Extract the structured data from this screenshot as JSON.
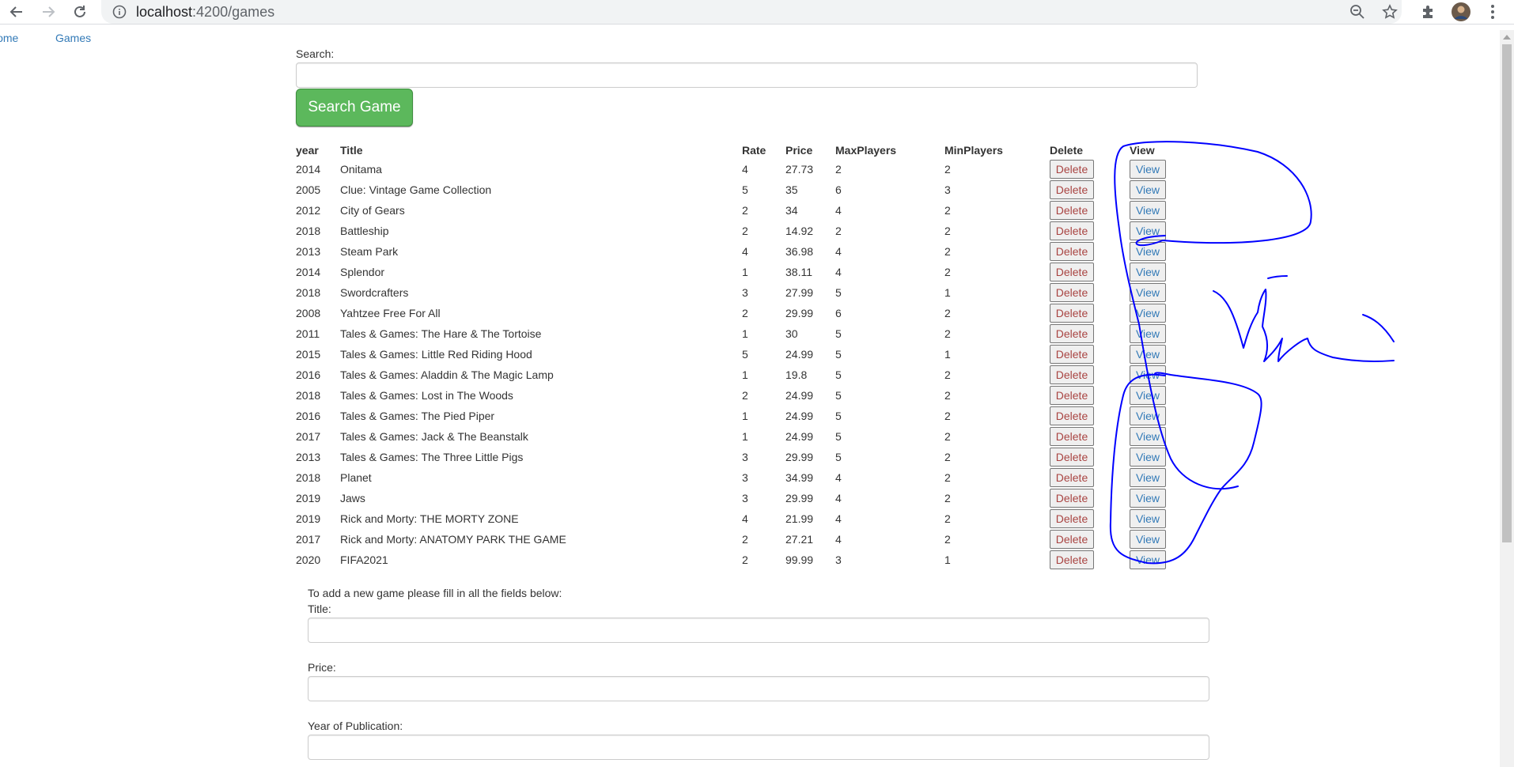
{
  "browser": {
    "url_host": "localhost",
    "url_path": ":4200/games"
  },
  "nav": {
    "home": "Home",
    "games": "Games"
  },
  "search": {
    "label": "Search:",
    "value": "",
    "button": "Search Game"
  },
  "table": {
    "headers": {
      "year": "year",
      "title": "Title",
      "rate": "Rate",
      "price": "Price",
      "max": "MaxPlayers",
      "min": "MinPlayers",
      "delete": "Delete",
      "view": "View"
    },
    "delete_label": "Delete",
    "view_label": "View",
    "rows": [
      {
        "year": "2014",
        "title": "Onitama",
        "rate": "4",
        "price": "27.73",
        "max": "2",
        "min": "2"
      },
      {
        "year": "2005",
        "title": "Clue: Vintage Game Collection",
        "rate": "5",
        "price": "35",
        "max": "6",
        "min": "3"
      },
      {
        "year": "2012",
        "title": "City of Gears",
        "rate": "2",
        "price": "34",
        "max": "4",
        "min": "2"
      },
      {
        "year": "2018",
        "title": "Battleship",
        "rate": "2",
        "price": "14.92",
        "max": "2",
        "min": "2"
      },
      {
        "year": "2013",
        "title": "Steam Park",
        "rate": "4",
        "price": "36.98",
        "max": "4",
        "min": "2"
      },
      {
        "year": "2014",
        "title": "Splendor",
        "rate": "1",
        "price": "38.11",
        "max": "4",
        "min": "2"
      },
      {
        "year": "2018",
        "title": "Swordcrafters",
        "rate": "3",
        "price": "27.99",
        "max": "5",
        "min": "1"
      },
      {
        "year": "2008",
        "title": "Yahtzee Free For All",
        "rate": "2",
        "price": "29.99",
        "max": "6",
        "min": "2"
      },
      {
        "year": "2011",
        "title": "Tales & Games: The Hare & The Tortoise",
        "rate": "1",
        "price": "30",
        "max": "5",
        "min": "2"
      },
      {
        "year": "2015",
        "title": "Tales & Games: Little Red Riding Hood",
        "rate": "5",
        "price": "24.99",
        "max": "5",
        "min": "1"
      },
      {
        "year": "2016",
        "title": "Tales & Games: Aladdin & The Magic Lamp",
        "rate": "1",
        "price": "19.8",
        "max": "5",
        "min": "2"
      },
      {
        "year": "2018",
        "title": "Tales & Games: Lost in The Woods",
        "rate": "2",
        "price": "24.99",
        "max": "5",
        "min": "2"
      },
      {
        "year": "2016",
        "title": "Tales & Games: The Pied Piper",
        "rate": "1",
        "price": "24.99",
        "max": "5",
        "min": "2"
      },
      {
        "year": "2017",
        "title": "Tales & Games: Jack & The Beanstalk",
        "rate": "1",
        "price": "24.99",
        "max": "5",
        "min": "2"
      },
      {
        "year": "2013",
        "title": "Tales & Games: The Three Little Pigs",
        "rate": "3",
        "price": "29.99",
        "max": "5",
        "min": "2"
      },
      {
        "year": "2018",
        "title": "Planet",
        "rate": "3",
        "price": "34.99",
        "max": "4",
        "min": "2"
      },
      {
        "year": "2019",
        "title": "Jaws",
        "rate": "3",
        "price": "29.99",
        "max": "4",
        "min": "2"
      },
      {
        "year": "2019",
        "title": "Rick and Morty: THE MORTY ZONE",
        "rate": "4",
        "price": "21.99",
        "max": "4",
        "min": "2"
      },
      {
        "year": "2017",
        "title": "Rick and Morty: ANATOMY PARK THE GAME",
        "rate": "2",
        "price": "27.21",
        "max": "4",
        "min": "2"
      },
      {
        "year": "2020",
        "title": "FIFA2021",
        "rate": "2",
        "price": "99.99",
        "max": "3",
        "min": "1"
      }
    ]
  },
  "add_form": {
    "intro": "To add a new game please fill in all the fields below:",
    "title_label": "Title:",
    "price_label": "Price:",
    "year_label": "Year of Publication:",
    "title_value": "",
    "price_value": "",
    "year_value": ""
  },
  "colors": {
    "link": "#337ab7",
    "success": "#5cb85c",
    "danger_text": "#a94442",
    "ink": "#0000ff"
  }
}
